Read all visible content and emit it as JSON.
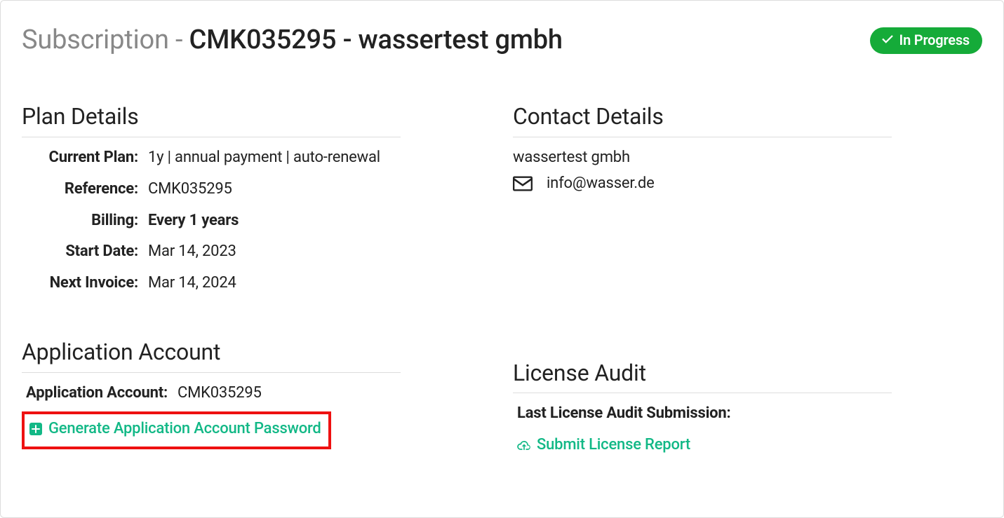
{
  "header": {
    "prefix": "Subscription - ",
    "title": "CMK035295 - wassertest gmbh",
    "status": "In Progress"
  },
  "plan": {
    "heading": "Plan Details",
    "current_plan_label": "Current Plan:",
    "current_plan_value": "1y | annual payment | auto-renewal",
    "reference_label": "Reference:",
    "reference_value": "CMK035295",
    "billing_label": "Billing:",
    "billing_value": "Every 1 years",
    "start_label": "Start Date:",
    "start_value": "Mar 14, 2023",
    "next_invoice_label": "Next Invoice:",
    "next_invoice_value": "Mar 14, 2024"
  },
  "contact": {
    "heading": "Contact Details",
    "company": "wassertest gmbh",
    "email": "info@wasser.de"
  },
  "app": {
    "heading": "Application Account",
    "account_label": "Application Account:",
    "account_value": "CMK035295",
    "generate_link": "Generate Application Account Password"
  },
  "license": {
    "heading": "License Audit",
    "last_submission_label": "Last License Audit Submission:",
    "submit_link": "Submit License Report"
  },
  "colors": {
    "accent_green": "#15ab39",
    "link_green": "#12b886",
    "highlight_red": "#e11"
  }
}
